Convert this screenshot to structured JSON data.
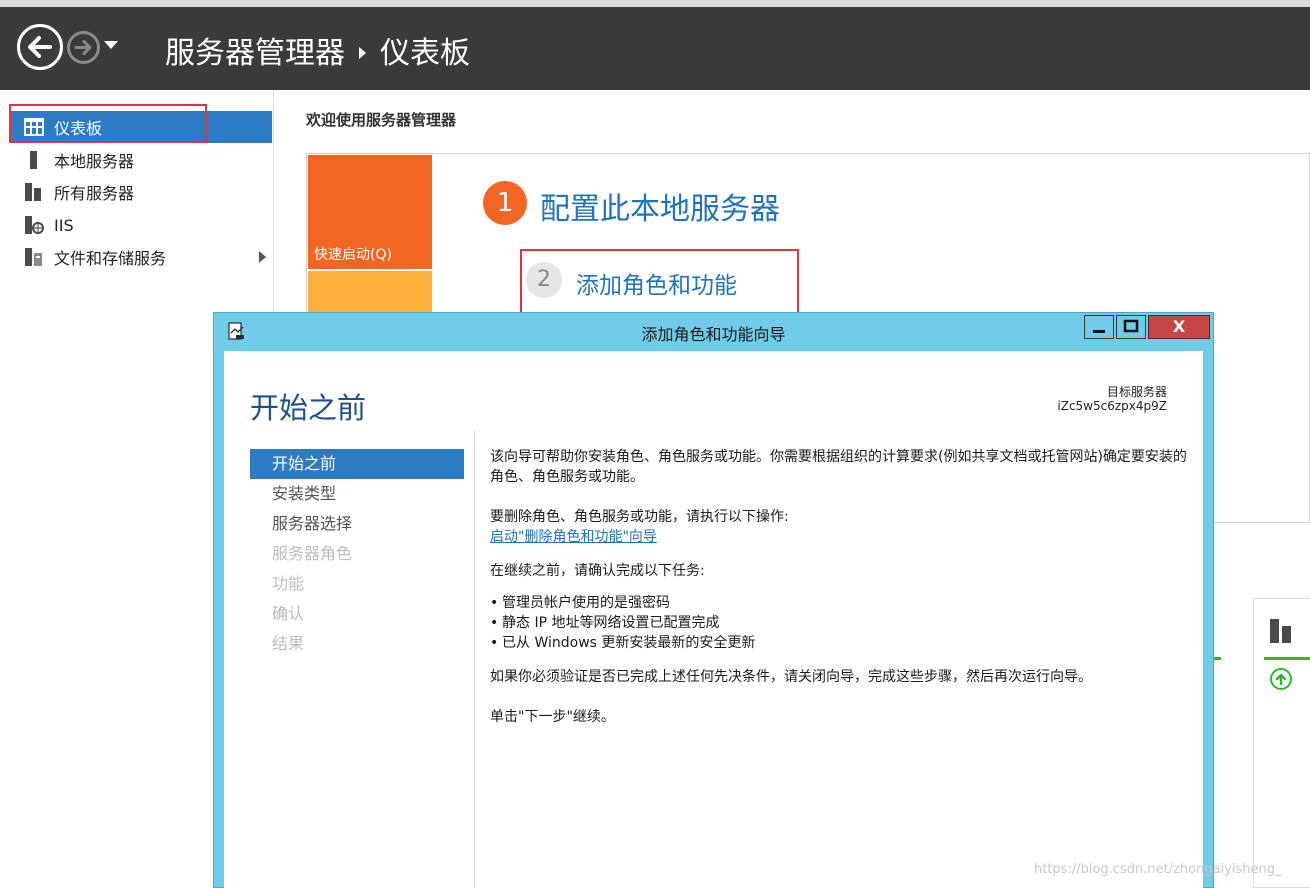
{
  "header": {
    "app_title": "服务器管理器",
    "page_title": "仪表板"
  },
  "sidebar": {
    "items": [
      {
        "label": "仪表板",
        "icon": "dashboard-icon",
        "active": true
      },
      {
        "label": "本地服务器",
        "icon": "local-server-icon",
        "active": false
      },
      {
        "label": "所有服务器",
        "icon": "all-servers-icon",
        "active": false
      },
      {
        "label": "IIS",
        "icon": "iis-icon",
        "active": false
      },
      {
        "label": "文件和存储服务",
        "icon": "file-storage-icon",
        "active": false
      }
    ]
  },
  "main": {
    "welcome": "欢迎使用服务器管理器",
    "quick_start_label": "快速启动(Q)",
    "step1_number": "1",
    "step1_label": "配置此本地服务器",
    "step2_number": "2",
    "step2_label": "添加角色和功能"
  },
  "wizard": {
    "title": "添加角色和功能向导",
    "heading": "开始之前",
    "target_label": "目标服务器",
    "target_value": "iZc5w5c6zpx4p9Z",
    "close_glyph": "X",
    "nav": [
      {
        "label": "开始之前",
        "state": "active"
      },
      {
        "label": "安装类型",
        "state": "normal"
      },
      {
        "label": "服务器选择",
        "state": "normal"
      },
      {
        "label": "服务器角色",
        "state": "disabled"
      },
      {
        "label": "功能",
        "state": "disabled"
      },
      {
        "label": "确认",
        "state": "disabled"
      },
      {
        "label": "结果",
        "state": "disabled"
      }
    ],
    "intro": "该向导可帮助你安装角色、角色服务或功能。你需要根据组织的计算要求(例如共享文档或托管网站)确定要安装的角色、角色服务或功能。",
    "remove_prompt": "要删除角色、角色服务或功能，请执行以下操作:",
    "remove_link": "启动\"删除角色和功能\"向导",
    "before_continue": "在继续之前，请确认完成以下任务:",
    "tasks": [
      "管理员帐户使用的是强密码",
      "静态 IP 地址等网络设置已配置完成",
      "已从 Windows 更新安装最新的安全更新"
    ],
    "verify_note": "如果你必须验证是否已完成上述任何先决条件，请关闭向导，完成这些步骤，然后再次运行向导。",
    "next_note": "单击\"下一步\"继续。"
  },
  "watermark": "https://blog.csdn.net/zhongaiyisheng_",
  "colors": {
    "header_bg": "#3b3b3b",
    "accent_blue": "#2d7bc5",
    "link_blue": "#1e73be",
    "quick_start_orange": "#f26522",
    "wizard_frame": "#6fcbe8",
    "highlight_red": "#e0343b"
  }
}
